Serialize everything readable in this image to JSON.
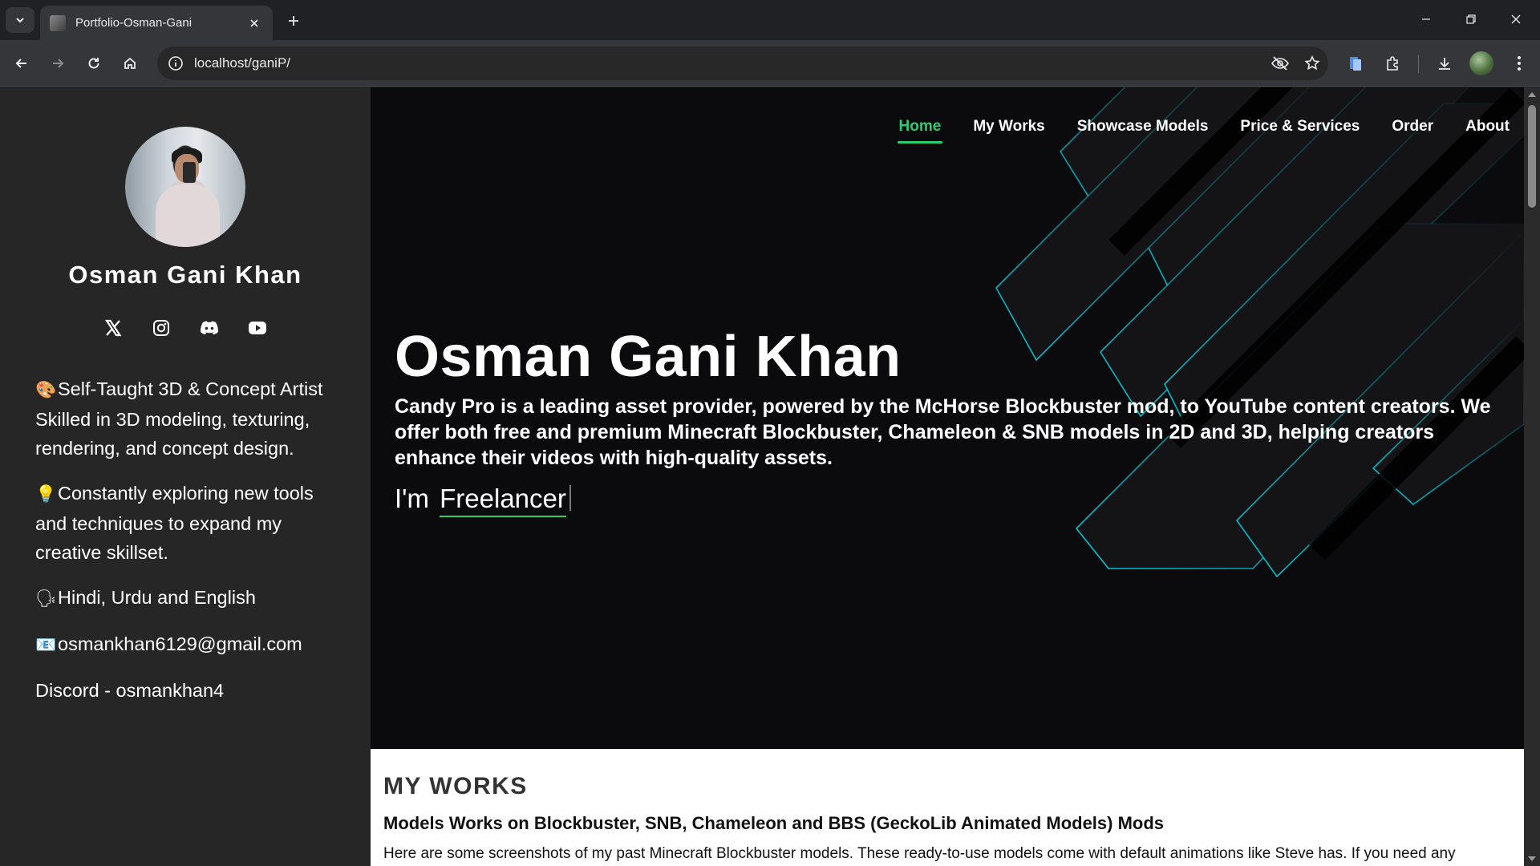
{
  "browser": {
    "tab_title": "Portfolio-Osman-Gani",
    "url": "localhost/ganiP/"
  },
  "sidebar": {
    "name": "Osman Gani Khan",
    "socials": [
      "x-icon",
      "instagram-icon",
      "discord-icon",
      "youtube-icon"
    ],
    "bio": [
      {
        "emoji": "🎨",
        "text": "Self-Taught 3D & Concept Artist Skilled in 3D modeling, texturing, rendering, and concept design."
      },
      {
        "emoji": "💡",
        "text": "Constantly exploring new tools and techniques to expand my creative skillset."
      },
      {
        "emoji": "🗣",
        "text": "Hindi, Urdu and English"
      },
      {
        "emoji": "📧",
        "text": "osmankhan6129@gmail.com"
      },
      {
        "emoji": "",
        "text": "Discord - osmankhan4"
      }
    ]
  },
  "nav": {
    "home": "Home",
    "works": "My Works",
    "showcase": "Showcase Models",
    "pricing": "Price & Services",
    "order": "Order",
    "about": "About"
  },
  "hero": {
    "title": "Osman Gani Khan",
    "description": "Candy Pro is a leading asset provider, powered by the McHorse Blockbuster mod, to YouTube content creators. We offer both free and premium Minecraft Blockbuster, Chameleon & SNB models in 2D and 3D, helping creators enhance their videos with high-quality assets.",
    "typed_prefix": "I'm",
    "typed_word": "Freelancer"
  },
  "works": {
    "heading": "MY WORKS",
    "subheading": "Models Works on Blockbuster, SNB, Chameleon and BBS (GeckoLib Animated Models) Mods",
    "text": "Here are some screenshots of my past Minecraft Blockbuster models. These ready-to-use models come with default animations like Steve has. If you need any"
  },
  "colors": {
    "accent": "#2ecc71",
    "hero_lines": "#00d4e6"
  }
}
